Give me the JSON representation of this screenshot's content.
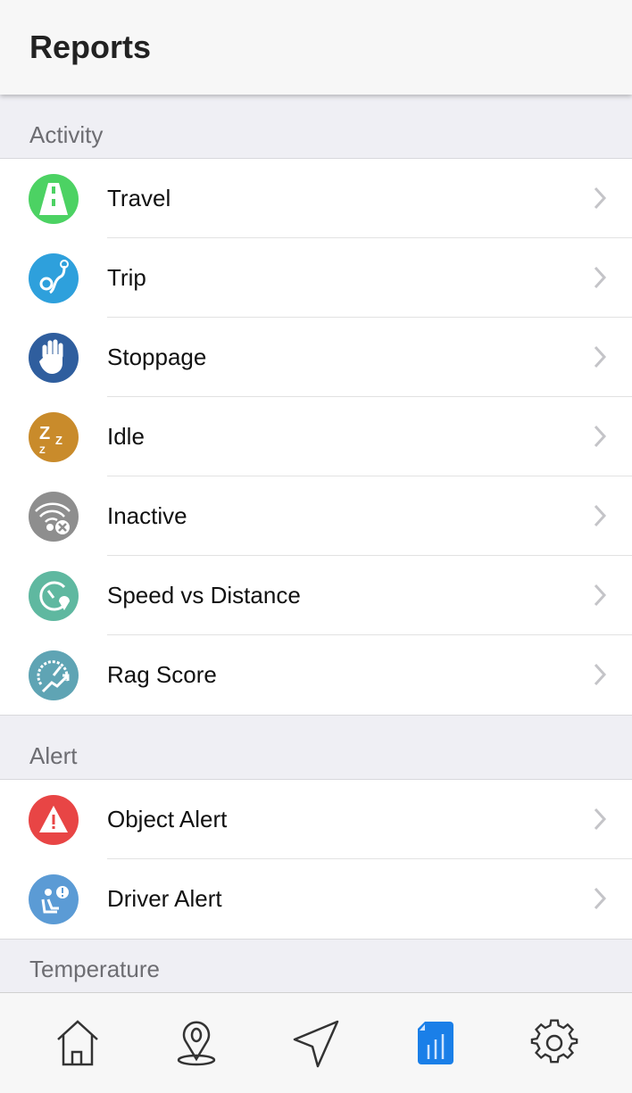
{
  "header": {
    "title": "Reports"
  },
  "sections": [
    {
      "title": "Activity",
      "items": [
        {
          "label": "Travel",
          "icon": "road-icon",
          "color": "#4cd263"
        },
        {
          "label": "Trip",
          "icon": "route-icon",
          "color": "#2ea0dc"
        },
        {
          "label": "Stoppage",
          "icon": "hand-icon",
          "color": "#2f5e9e"
        },
        {
          "label": "Idle",
          "icon": "sleep-icon",
          "color": "#c98b2b"
        },
        {
          "label": "Inactive",
          "icon": "wifi-off-icon",
          "color": "#8e8e8e"
        },
        {
          "label": "Speed vs Distance",
          "icon": "speed-distance-icon",
          "color": "#5fb8a0"
        },
        {
          "label": "Rag Score",
          "icon": "speedometer-icon",
          "color": "#5fa4b4"
        }
      ]
    },
    {
      "title": "Alert",
      "items": [
        {
          "label": "Object Alert",
          "icon": "warning-icon",
          "color": "#e84545"
        },
        {
          "label": "Driver Alert",
          "icon": "driver-alert-icon",
          "color": "#5b9bd5"
        }
      ]
    },
    {
      "title": "Temperature",
      "items": []
    }
  ],
  "nav": {
    "items": [
      "home-icon",
      "location-pin-icon",
      "navigation-icon",
      "reports-icon",
      "settings-icon"
    ],
    "active": "reports-icon",
    "active_color": "#1a7fe8"
  }
}
